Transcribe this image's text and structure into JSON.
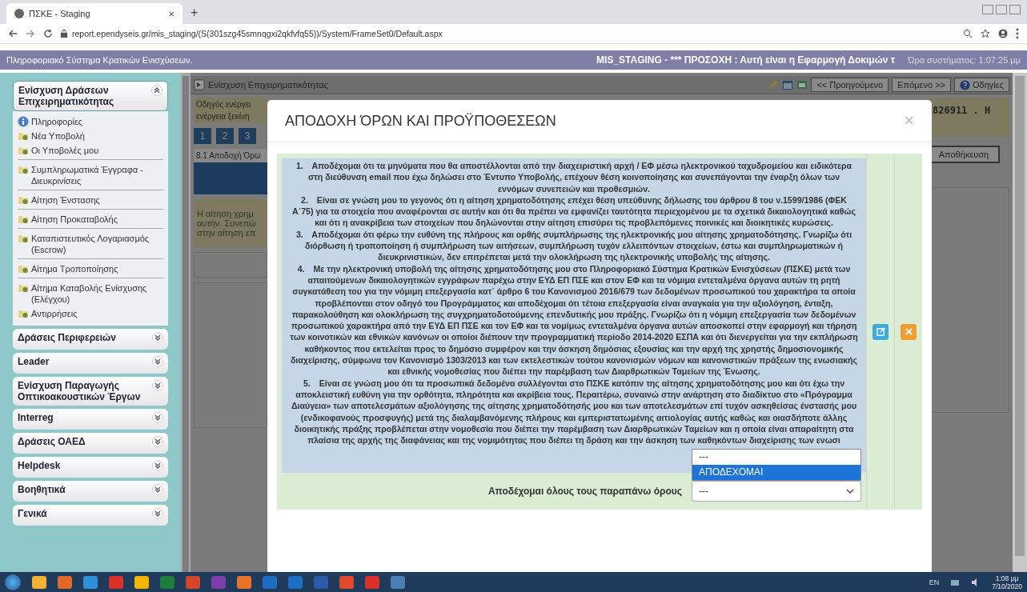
{
  "browser": {
    "tab_title": "ΠΣΚΕ - Staging",
    "tab_close": "×",
    "new_tab": "+",
    "url": "report.ependyseis.gr/mis_staging/(S(301szg45smnqgxi2qkfvfq55))/System/FrameSet0/Default.aspx"
  },
  "header": {
    "title": "Πληροφοριακό Σύστημα Κρατικών Ενισχύσεων.",
    "warning": "MIS_STAGING - *** ΠΡΟΣΟΧΗ : Αυτή είναι η Εφαρμογή Δοκιμών τ",
    "clock": "Ώρα συστήματος: 1:07:25 μμ"
  },
  "sidebar": {
    "groups": [
      {
        "label": "Ενίσχυση Δράσεων Επιχειρηματικότητας",
        "expanded": true,
        "items": [
          {
            "label": "Πληροφορίες",
            "kind": "info",
            "divider_after": false
          },
          {
            "label": "Νέα Υποβολή",
            "kind": "folder",
            "divider_after": false
          },
          {
            "label": "Οι Υποβολές μου",
            "kind": "folder",
            "divider_after": true
          },
          {
            "label": "Συμπληρωματικά Έγγραφα - Διευκρινίσεις",
            "kind": "folder",
            "divider_after": true
          },
          {
            "label": "Αίτηση Ένστασης",
            "kind": "folder",
            "divider_after": true
          },
          {
            "label": "Αίτηση Προκαταβολής",
            "kind": "folder",
            "divider_after": true
          },
          {
            "label": "Καταπιστευτικός Λογαριασμός (Escrow)",
            "kind": "folder",
            "divider_after": true
          },
          {
            "label": "Αίτημα Τροποποίησης",
            "kind": "folder",
            "divider_after": true
          },
          {
            "label": "Αίτημα Καταβολής Ενίσχυσης (Ελέγχου)",
            "kind": "folder",
            "divider_after": false
          },
          {
            "label": "Αντιρρήσεις",
            "kind": "folder",
            "divider_after": false
          }
        ]
      },
      {
        "label": "Δράσεις Περιφερειών",
        "expanded": false
      },
      {
        "label": "Leader",
        "expanded": false
      },
      {
        "label": "Ενίσχυση Παραγωγής Οπτικοακουστικών Έργων",
        "expanded": false
      },
      {
        "label": "Interreg",
        "expanded": false
      },
      {
        "label": "Δράσεις ΟΑΕΔ",
        "expanded": false
      },
      {
        "label": "Helpdesk",
        "expanded": false
      },
      {
        "label": "Βοηθητικά",
        "expanded": false
      },
      {
        "label": "Γενικά",
        "expanded": false
      }
    ]
  },
  "background": {
    "toolbar_title": "Ενίσχυση Επιχειρηματικότητας",
    "nav_buttons": [
      "<< Προηγούμενο",
      "Επόμενο >>"
    ],
    "help_button": "Οδηγίες",
    "guide_lines": [
      "Οδηγός ενέργει",
      "ενέργεια ξεκίνη"
    ],
    "steps": [
      "1",
      "2",
      "3"
    ],
    "section_tab": "8.1 Αποδοχή Όρω",
    "notice_lines": [
      "Η αίτηση χρημ",
      "αυτήν. Συνεπώ",
      "στην αίτηση επ"
    ],
    "code_text": "826911 . Η",
    "save_button": "Αποθήκευση"
  },
  "modal": {
    "title": "ΑΠΟΔΟΧΗ ΌΡΩΝ ΚΑΙ ΠΡΟΫΠΟΘΕΣΕΩΝ",
    "close": "×",
    "terms": [
      {
        "number": "1.",
        "text": "Αποδέχομαι ότι τα μηνύματα που θα αποστέλλονται από την διαχειριστική αρχή / ΕΦ μέσω ηλεκτρονικού ταχυδρομείου και ειδικότερα στη διεύθυνση email που έχω δηλώσει στο Έντυπο Υποβολής, επέχουν θέση κοινοποίησης και συνεπάγονται την έναρξη όλων των εννόμων συνεπειών και προθεσμιών."
      },
      {
        "number": "2.",
        "text": "Είναι σε γνώση μου το γεγονός ότι η αίτηση χρηματοδότησης επέχει θέση υπεύθυνης δήλωσης του άρθρου 8 του ν.1599/1986 (ΦΕΚ Α΄75) για τα στοιχεία που αναφέρονται σε αυτήν και ότι θα πρέπει να εμφανίζει ταυτότητα περιεχομένου με τα σχετικά δικαιολογητικά καθώς και ότι η ανακρίβεια των στοιχείων που δηλώνονται στην αίτηση επισύρει τις προβλεπόμενες ποινικές και διοικητικές κυρώσεις."
      },
      {
        "number": "3.",
        "text": "Αποδέχομαι ότι φέρω την ευθύνη της πλήρους και ορθής συμπλήρωσης της ηλεκτρονικής μου αίτησης χρηματοδότησης. Γνωρίζω ότι διόρθωση ή τροποποίηση ή συμπλήρωση των αιτήσεων, συμπλήρωση τυχόν ελλειπόντων στοιχείων, έστω και συμπληρωματικών ή διευκρινιστικών, δεν επιτρέπεται μετά την ολοκλήρωση της ηλεκτρονικής υποβολής της αίτησης."
      },
      {
        "number": "4.",
        "text": "Με την ηλεκτρονική υποβολή της αίτησης χρηματοδότησης μου στο Πληροφοριακό Σύστημα Κρατικών Ενισχύσεων (ΠΣΚΕ) μετά των απαιτούμενων δικαιολογητικών εγγράφων παρέχω στην ΕΥΔ ΕΠ ΠΣΕ και στον ΕΦ και τα νόμιμα εντεταλμένα όργανα αυτών τη ρητή συγκατάθεση του για την νόμιμη επεξεργασία κατ΄ άρθρο 6 του Κανονισμού 2016/679 των δεδομένων προσωπικού του χαρακτήρα τα οποία προβλέπονται στον οδηγό του Προγράμματος και αποδέχομαι ότι τέτοια επεξεργασία είναι αναγκαία για την αξιολόγηση, ένταξη, παρακολούθηση και ολοκλήρωση της συγχρηματοδοτούμενης επενδυτικής μου πράξης. Γνωρίζω ότι η νόμιμη επεξεργασία των δεδομένων προσωπικού χαρακτήρα από την ΕΥΔ ΕΠ ΠΣΕ και τον ΕΦ και τα νομίμως εντεταλμένα όργανα αυτών αποσκοπεί στην εφαρμογή και τήρηση των κοινοτικών και εθνικών κανόνων οι οποίοι διέπουν την προγραμματική περίοδο 2014-2020 ΕΣΠΑ και ότι διενεργείται για την εκπλήρωση καθήκοντος που εκτελείται προς το δημόσιο συμφέρον και την άσκηση δημόσιας εξουσίας και την αρχή της χρηστής δημοσιονομικής διαχείρισης, σύμφωνα τον Κανονισμό 1303/2013 και των εκτελεστικών τούτου κανονισμών νόμων και κανονιστικών πράξεων της ενωσιακής και εθνικής νομοθεσίας που διέπει την παρέμβαση των Διαρθρωτικών Ταμείων της Ένωσης."
      },
      {
        "number": "5.",
        "text": "Είναι σε γνώση μου ότι τα προσωπικά δεδομένα συλλέγονται στο ΠΣΚΕ κατόπιν της αίτησης χρηματοδότησης μου και ότι έχω την αποκλειστική ευθύνη για την ορθότητα, πληρότητα και ακρίβεια τους. Περαιτέρω, συναινώ στην ανάρτηση στο διαδίκτυο στο «Πρόγραμμα Διαύγεια» των αποτελεσμάτων αξιολόγησης της αίτησης χρηματοδότησής μου και των αποτελεσμάτων επί τυχόν ασκηθείσας ένστασής μου (ενδικοφανούς προσφυγής) μετά της διαλαμβανόμενης πλήρους και εμπεριστατωμένης αιτιολογίας αυτής καθώς και οιασδήποτε άλλης διοικητικής πράξης προβλέπεται στην νομοθεσία που διέπει την παρέμβαση των Διαρθρωτικών Ταμείων και η οποία είναι απαραίτητη στα πλαίσια της αρχής της διαφάνειας και της νομιμότητας που διέπει τη δράση και την άσκηση των καθηκόντων διαχείρισης των ενωσι"
      }
    ],
    "accept_label": "Αποδέχομαι όλους τους παραπάνω όρους",
    "select": {
      "value": "---",
      "expanded": true,
      "options": [
        {
          "label": "---",
          "highlighted": false
        },
        {
          "label": "ΑΠΟΔΕΧΟΜΑΙ",
          "highlighted": true
        }
      ]
    }
  },
  "taskbar": {
    "language": "EN",
    "time": "1:08 μμ",
    "date": "7/10/2020"
  }
}
